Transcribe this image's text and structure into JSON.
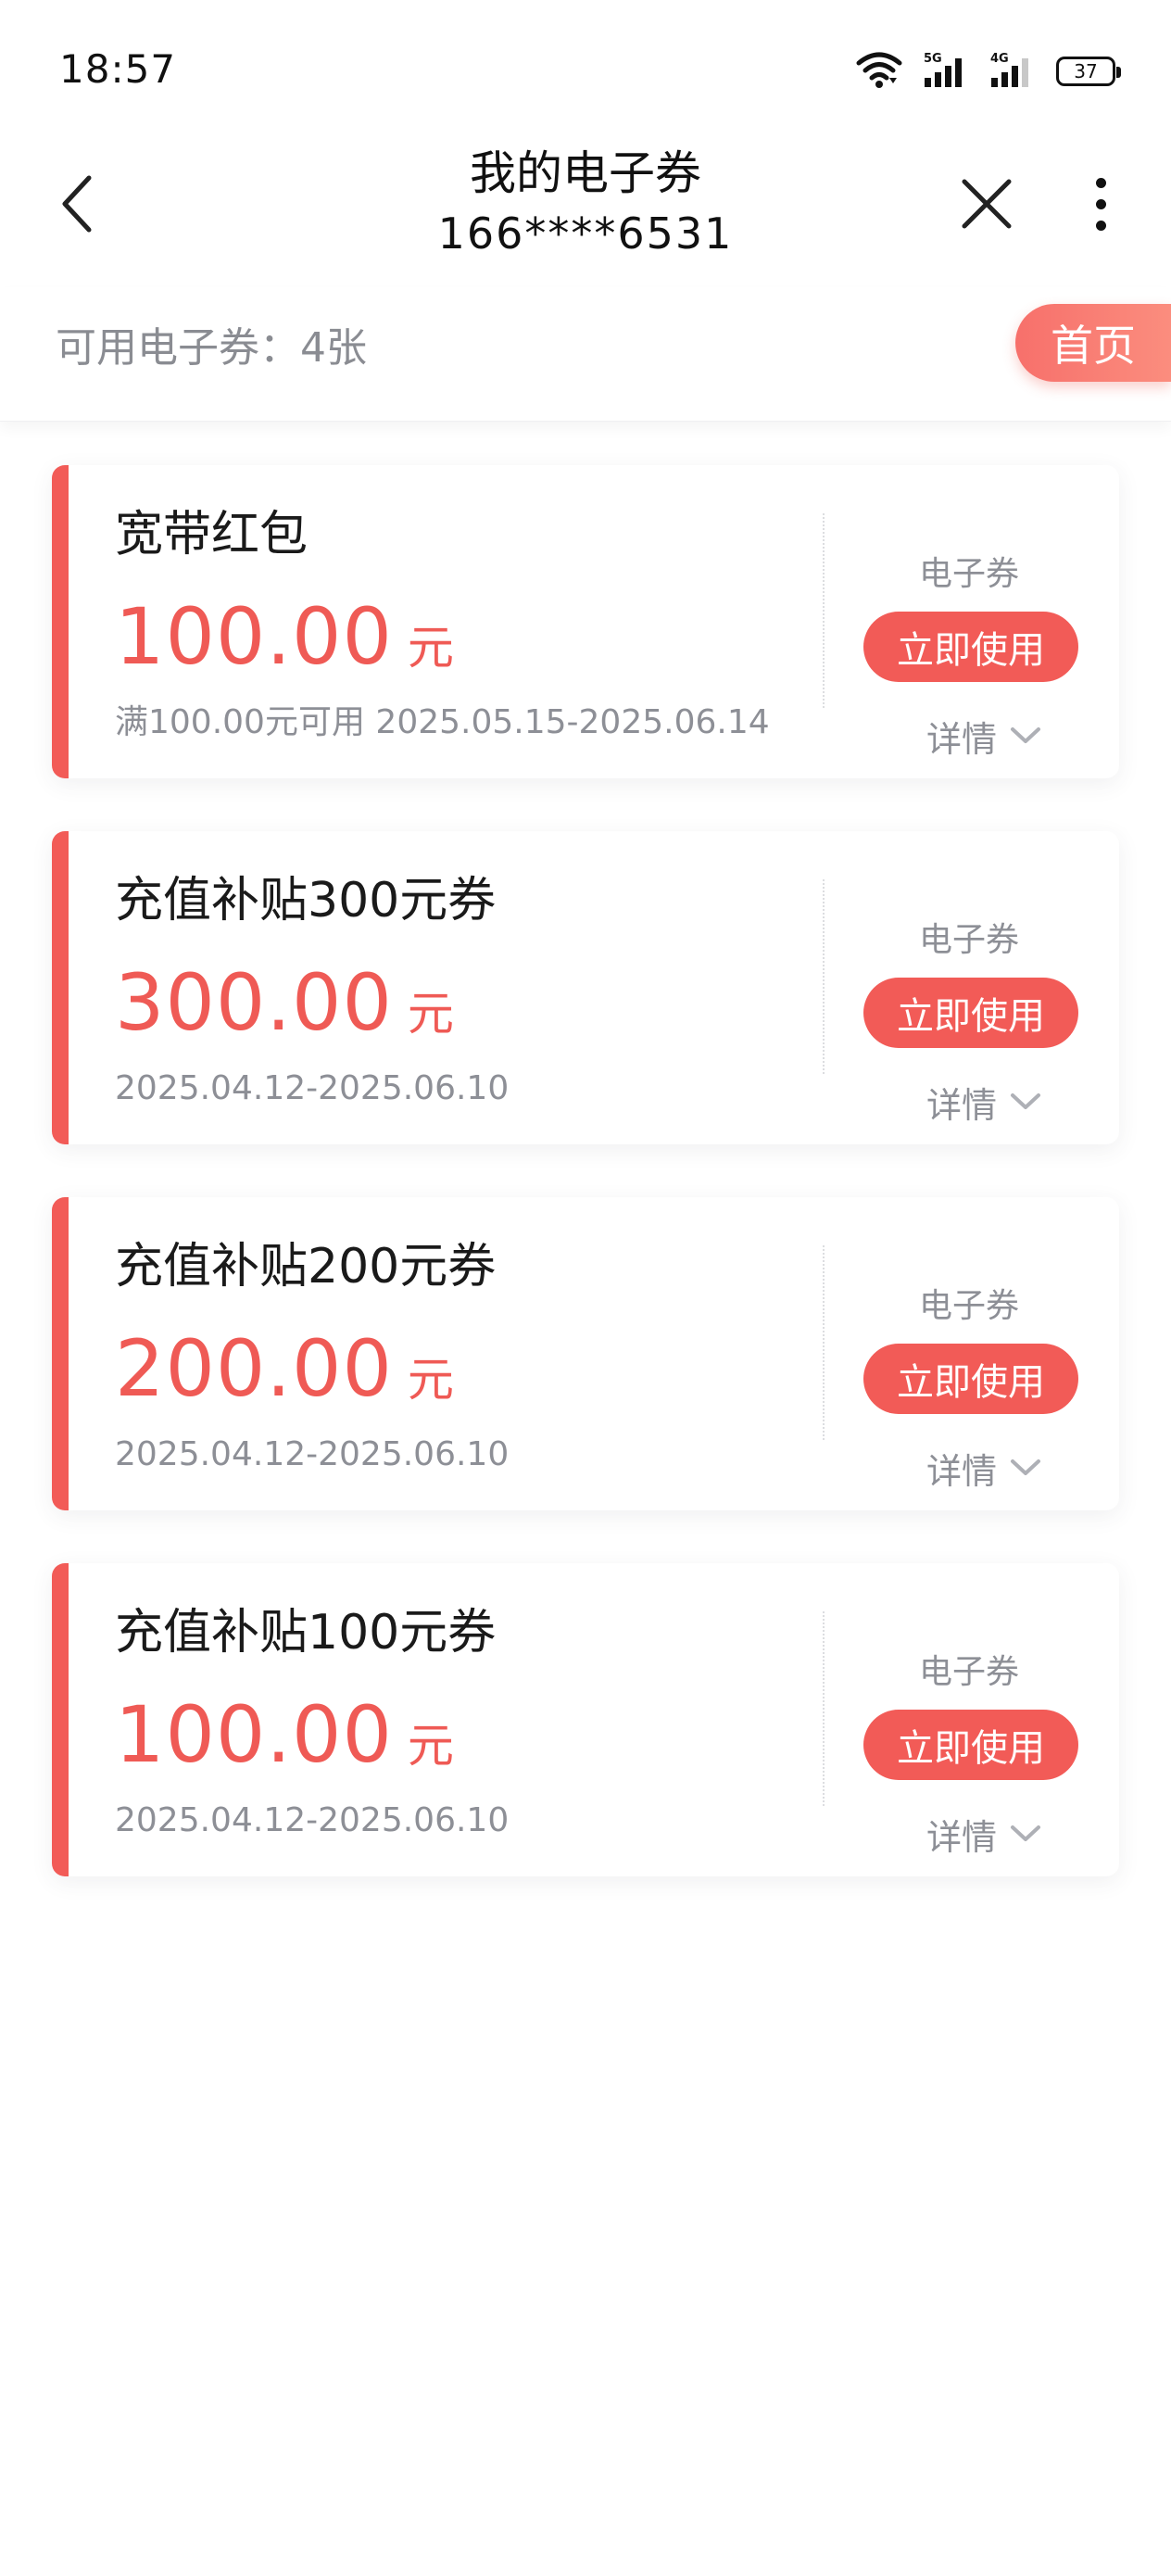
{
  "status_bar": {
    "time": "18:57",
    "battery": "37",
    "icons": [
      "wifi-icon",
      "signal-5g-icon",
      "signal-4g-icon",
      "battery-icon"
    ]
  },
  "header": {
    "title": "我的电子券",
    "subtitle": "166****6531",
    "back_icon": "chevron-left-icon",
    "close_icon": "close-icon",
    "more_icon": "more-vertical-icon"
  },
  "summary": {
    "available_text": "可用电子券：4张",
    "home_label": "首页"
  },
  "colors": {
    "accent": "#f25b57",
    "amount": "#ef5a55",
    "muted_text": "#8d8f96"
  },
  "coupons": [
    {
      "name": "宽带红包",
      "amount": "100.00",
      "unit": "元",
      "desc": "满100.00元可用 2025.05.15-2025.06.14",
      "type": "电子券",
      "action": "立即使用",
      "detail": "详情"
    },
    {
      "name": "充值补贴300元券",
      "amount": "300.00",
      "unit": "元",
      "desc": "2025.04.12-2025.06.10",
      "type": "电子券",
      "action": "立即使用",
      "detail": "详情"
    },
    {
      "name": "充值补贴200元券",
      "amount": "200.00",
      "unit": "元",
      "desc": "2025.04.12-2025.06.10",
      "type": "电子券",
      "action": "立即使用",
      "detail": "详情"
    },
    {
      "name": "充值补贴100元券",
      "amount": "100.00",
      "unit": "元",
      "desc": "2025.04.12-2025.06.10",
      "type": "电子券",
      "action": "立即使用",
      "detail": "详情"
    }
  ]
}
